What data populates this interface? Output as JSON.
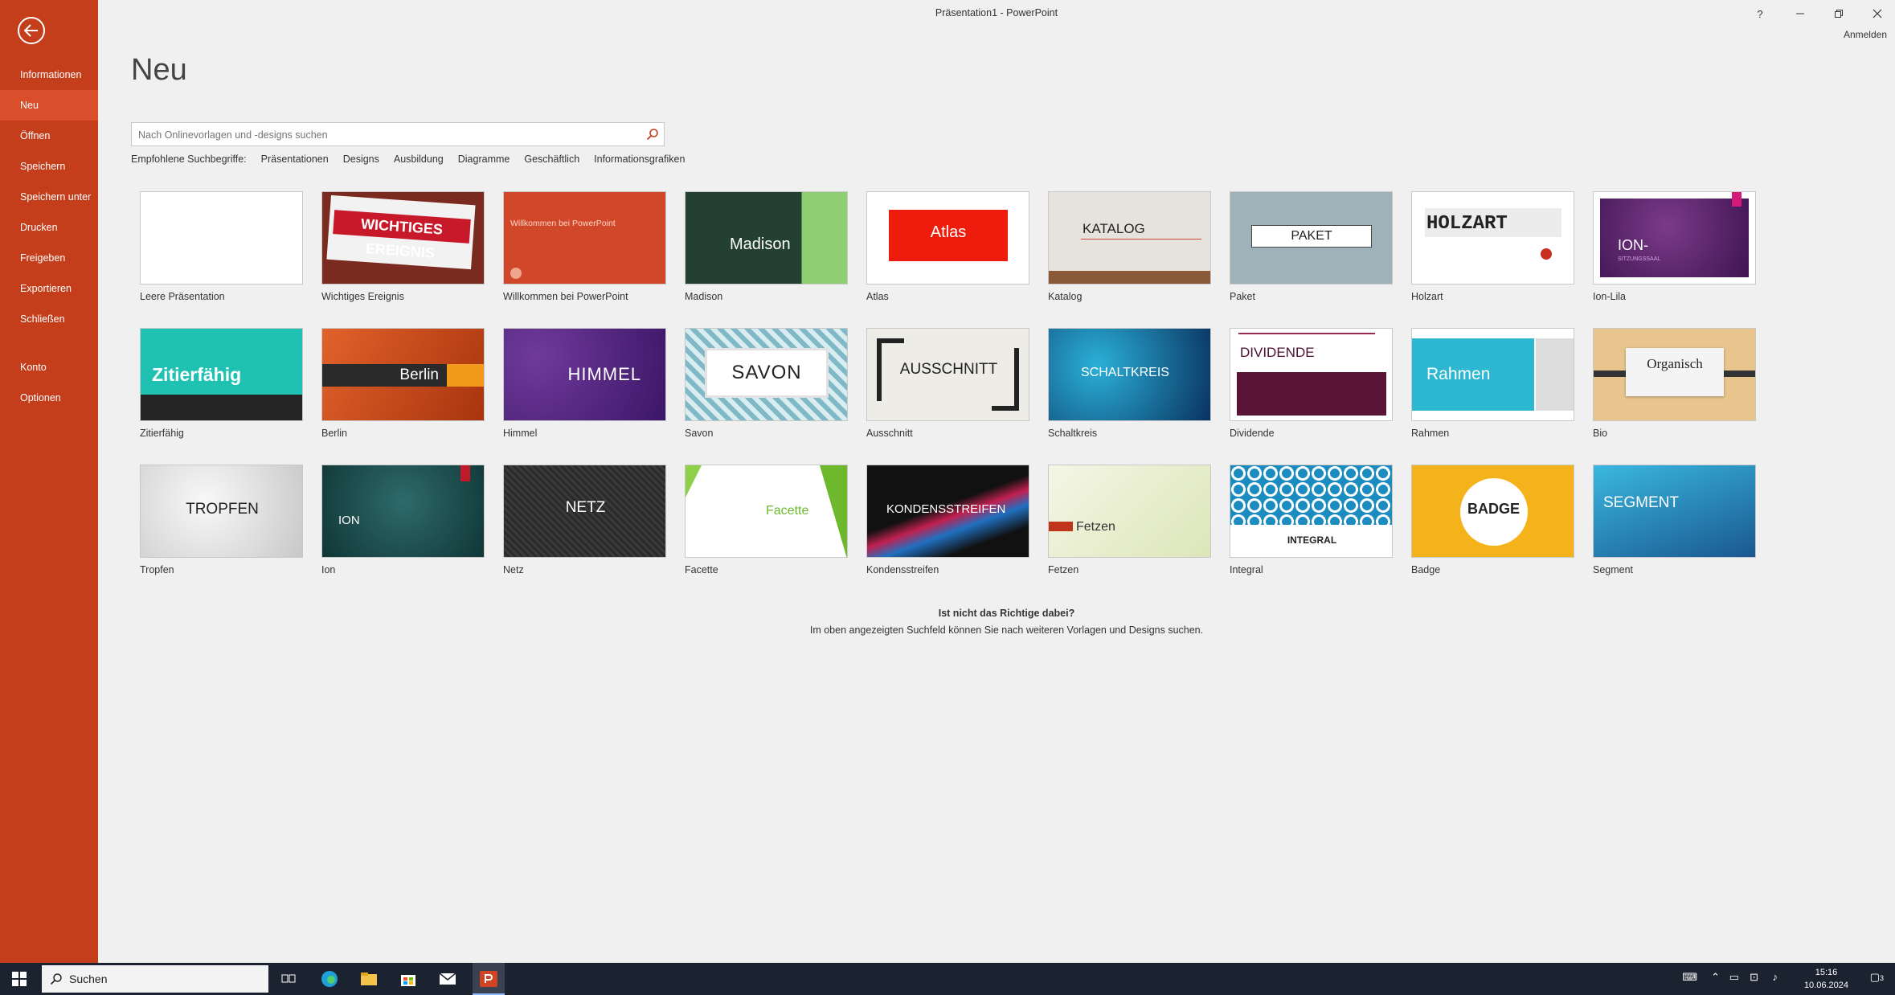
{
  "window": {
    "title": "Präsentation1 - PowerPoint",
    "sign_in": "Anmelden",
    "help": "?"
  },
  "sidebar": {
    "items": [
      {
        "label": "Informationen"
      },
      {
        "label": "Neu",
        "active": true
      },
      {
        "label": "Öffnen"
      },
      {
        "label": "Speichern"
      },
      {
        "label": "Speichern unter"
      },
      {
        "label": "Drucken"
      },
      {
        "label": "Freigeben"
      },
      {
        "label": "Exportieren"
      },
      {
        "label": "Schließen"
      }
    ],
    "bottom_items": [
      {
        "label": "Konto"
      },
      {
        "label": "Optionen"
      }
    ]
  },
  "main": {
    "heading": "Neu",
    "search_placeholder": "Nach Onlinevorlagen und -designs suchen",
    "suggestions_label": "Empfohlene Suchbegriffe:",
    "suggestions": [
      "Präsentationen",
      "Designs",
      "Ausbildung",
      "Diagramme",
      "Geschäftlich",
      "Informationsgrafiken"
    ],
    "templates": [
      {
        "name": "Leere Präsentation",
        "thumb_text": ""
      },
      {
        "name": "Wichtiges Ereignis",
        "thumb_text": "WICHTIGES EREIGNIS"
      },
      {
        "name": "Willkommen bei PowerPoint",
        "thumb_text": "Willkommen bei PowerPoint"
      },
      {
        "name": "Madison",
        "thumb_text": "Madison"
      },
      {
        "name": "Atlas",
        "thumb_text": "Atlas"
      },
      {
        "name": "Katalog",
        "thumb_text": "KATALOG"
      },
      {
        "name": "Paket",
        "thumb_text": "PAKET"
      },
      {
        "name": "Holzart",
        "thumb_text": "HOLZART"
      },
      {
        "name": "Ion-Lila",
        "thumb_text": "ION-",
        "thumb_sub": "SITZUNGSSAAL"
      },
      {
        "name": "Zitierfähig",
        "thumb_text": "Zitierfähig"
      },
      {
        "name": "Berlin",
        "thumb_text": "Berlin"
      },
      {
        "name": "Himmel",
        "thumb_text": "HIMMEL"
      },
      {
        "name": "Savon",
        "thumb_text": "SAVON"
      },
      {
        "name": "Ausschnitt",
        "thumb_text": "AUSSCHNITT"
      },
      {
        "name": "Schaltkreis",
        "thumb_text": "SCHALTKREIS"
      },
      {
        "name": "Dividende",
        "thumb_text": "DIVIDENDE"
      },
      {
        "name": "Rahmen",
        "thumb_text": "Rahmen"
      },
      {
        "name": "Bio",
        "thumb_text": "Organisch"
      },
      {
        "name": "Tropfen",
        "thumb_text": "TROPFEN"
      },
      {
        "name": "Ion",
        "thumb_text": "ION"
      },
      {
        "name": "Netz",
        "thumb_text": "NETZ"
      },
      {
        "name": "Facette",
        "thumb_text": "Facette"
      },
      {
        "name": "Kondensstreifen",
        "thumb_text": "KONDENSSTREIFEN"
      },
      {
        "name": "Fetzen",
        "thumb_text": "Fetzen"
      },
      {
        "name": "Integral",
        "thumb_text": "INTEGRAL"
      },
      {
        "name": "Badge",
        "thumb_text": "BADGE"
      },
      {
        "name": "Segment",
        "thumb_text": "SEGMENT"
      }
    ],
    "footer_question": "Ist nicht das Richtige dabei?",
    "footer_text": "Im oben angezeigten Suchfeld können Sie nach weiteren Vorlagen und Designs suchen."
  },
  "taskbar": {
    "search_label": "Suchen",
    "time": "15:16",
    "date": "10.06.2024",
    "notification_count": "3"
  }
}
